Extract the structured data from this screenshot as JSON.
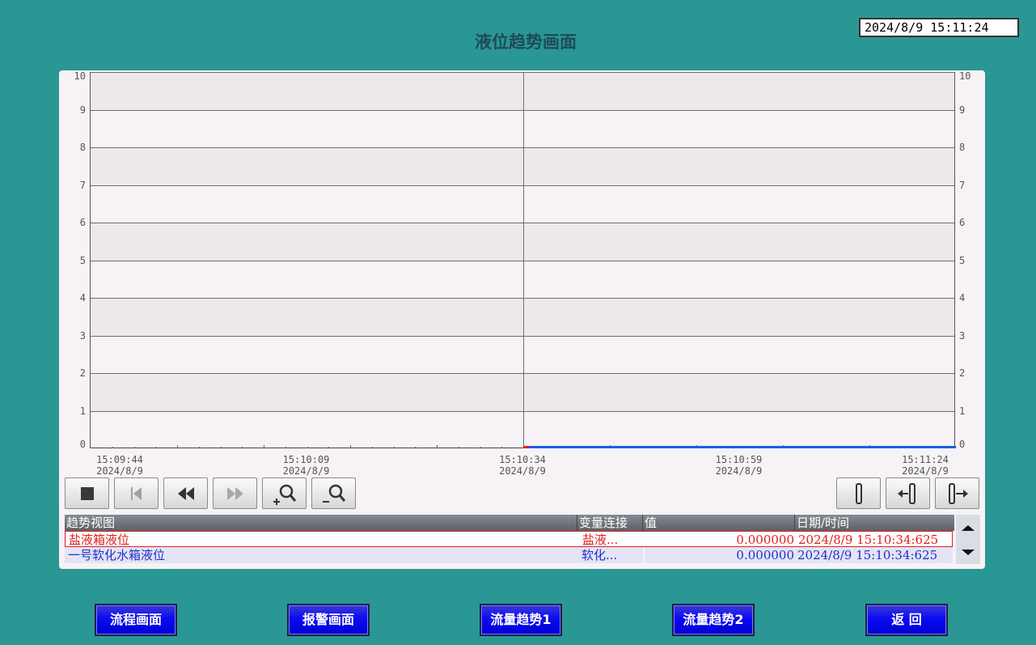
{
  "header": {
    "title": "液位趋势画面",
    "datetime": "2024/8/9 15:11:24"
  },
  "chart_data": {
    "type": "line",
    "ylim": [
      0,
      10
    ],
    "y_ticks": [
      "0",
      "1",
      "2",
      "3",
      "4",
      "5",
      "6",
      "7",
      "8",
      "9",
      "10"
    ],
    "x_ticks": [
      {
        "time": "15:09:44",
        "date": "2024/8/9"
      },
      {
        "time": "15:10:09",
        "date": "2024/8/9"
      },
      {
        "time": "15:10:34",
        "date": "2024/8/9"
      },
      {
        "time": "15:10:59",
        "date": "2024/8/9"
      },
      {
        "time": "15:11:24",
        "date": "2024/8/9"
      }
    ],
    "xlim": [
      "15:09:44",
      "15:11:24"
    ],
    "grid": true,
    "series": [
      {
        "name": "盐液箱液位",
        "color": "#e02020",
        "x": [
          "15:10:34",
          "15:10:34.625"
        ],
        "y": [
          0,
          0
        ]
      },
      {
        "name": "一号软化水箱液位",
        "color": "#1d5fe0",
        "x": [
          "15:10:34.625",
          "15:11:24"
        ],
        "y": [
          0,
          0
        ]
      }
    ]
  },
  "toolbar": {
    "left_icons": [
      "stop-icon",
      "first-page-icon",
      "rewind-icon",
      "forward-icon",
      "zoom-in-icon",
      "zoom-out-icon"
    ],
    "right_icons": [
      "ruler-icon",
      "ruler-left-icon",
      "ruler-right-icon"
    ]
  },
  "legend_table": {
    "headers": [
      "趋势视图",
      "变量连接",
      "值",
      "日期/时间"
    ],
    "rows": [
      {
        "name": "盐液箱液位",
        "tag": "盐液...",
        "value": "0.000000",
        "datetime": "2024/8/9  15:10:34:625",
        "color": "#e02020"
      },
      {
        "name": "一号软化水箱液位",
        "tag": "软化...",
        "value": "0.000000",
        "datetime": "2024/8/9  15:10:34:625",
        "color": "#1d2fd0"
      }
    ]
  },
  "nav": {
    "buttons": [
      "流程画面",
      "报警画面",
      "流量趋势1",
      "流量趋势2",
      "返 回"
    ]
  },
  "colors": {
    "background": "#2a9794",
    "button": "#0b0bf2"
  }
}
